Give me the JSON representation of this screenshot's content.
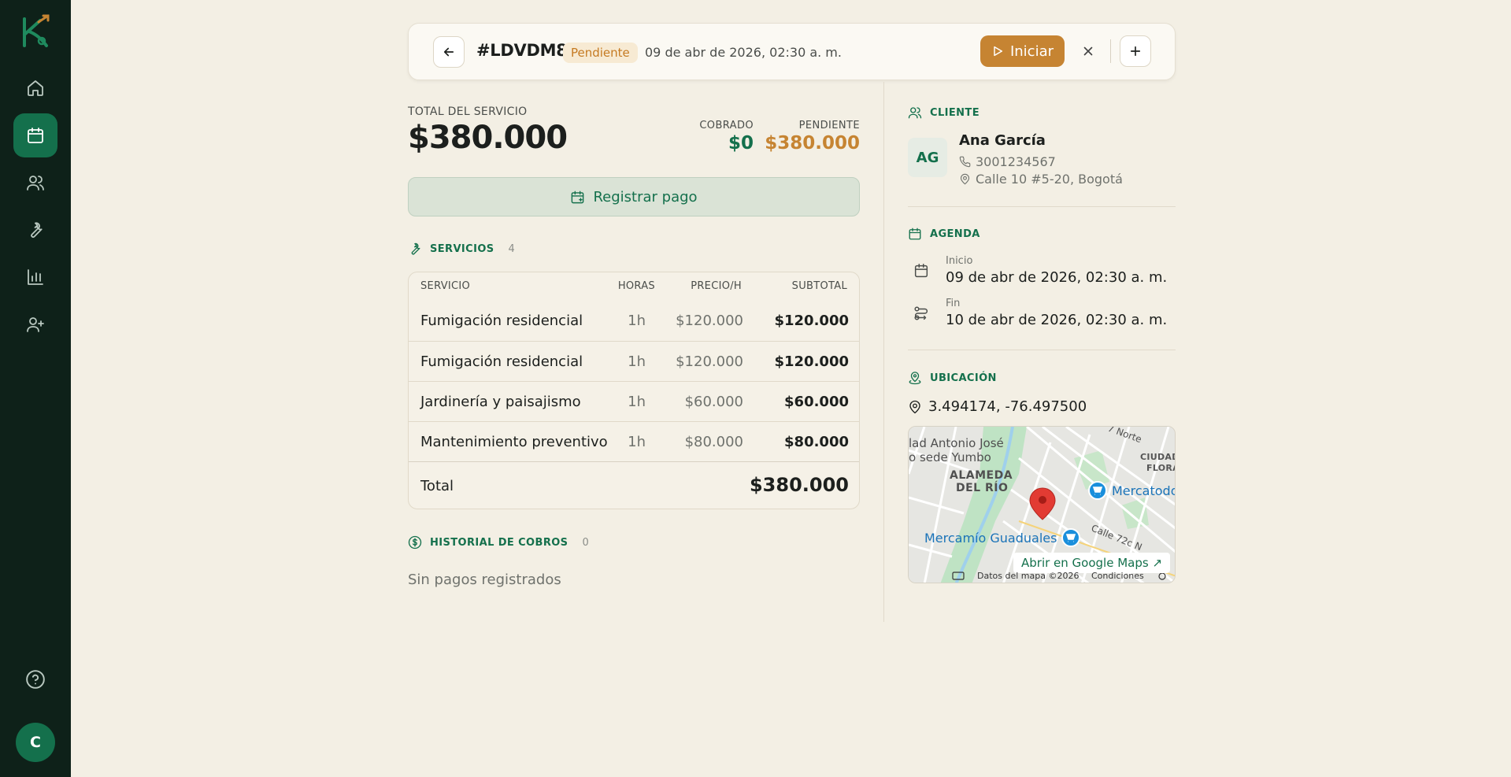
{
  "sidebar": {
    "user_initial": "C"
  },
  "header": {
    "order_id": "#LDVDM8",
    "status": "Pendiente",
    "date": "09 de abr de 2026, 02:30 a. m.",
    "start_label": "Iniciar"
  },
  "summary": {
    "total_label": "TOTAL DEL SERVICIO",
    "total_amount": "$380.000",
    "cobrado_label": "COBRADO",
    "cobrado_value": "$0",
    "pendiente_label": "PENDIENTE",
    "pendiente_value": "$380.000",
    "pay_button": "Registrar pago"
  },
  "services": {
    "title": "SERVICIOS",
    "count": "4",
    "headers": {
      "service": "SERVICIO",
      "hours": "HORAS",
      "price": "PRECIO/H",
      "subtotal": "SUBTOTAL"
    },
    "rows": [
      {
        "name": "Fumigación residencial",
        "hours": "1h",
        "price": "$120.000",
        "subtotal": "$120.000"
      },
      {
        "name": "Fumigación residencial",
        "hours": "1h",
        "price": "$120.000",
        "subtotal": "$120.000"
      },
      {
        "name": "Jardinería y paisajismo",
        "hours": "1h",
        "price": "$60.000",
        "subtotal": "$60.000"
      },
      {
        "name": "Mantenimiento preventivo",
        "hours": "1h",
        "price": "$80.000",
        "subtotal": "$80.000"
      }
    ],
    "total_label": "Total",
    "total_value": "$380.000"
  },
  "payments": {
    "title": "HISTORIAL DE COBROS",
    "count": "0",
    "empty": "Sin pagos registrados"
  },
  "client": {
    "title": "CLIENTE",
    "initials": "AG",
    "name": "Ana García",
    "phone": "3001234567",
    "address": "Calle 10 #5-20, Bogotá"
  },
  "agenda": {
    "title": "AGENDA",
    "start_label": "Inicio",
    "start_value": "09 de abr de 2026, 02:30 a. m.",
    "end_label": "Fin",
    "end_value": "10 de abr de 2026, 02:30 a. m."
  },
  "location": {
    "title": "UBICACIÓN",
    "coords": "3.494174, -76.497500",
    "map": {
      "label_1": "lad Antonio José",
      "label_2": "o sede Yumbo",
      "label_3": "ALAMEDA",
      "label_4": "DEL RÍO",
      "label_5": "Mercatodo",
      "label_6": "Mercamío Guaduales",
      "label_7": "CIUDADE",
      "label_8": "FLORAL",
      "label_9": "7 Norte",
      "label_10": "Calle 72c N",
      "open_link": "Abrir en Google Maps ↗",
      "data_label": "Datos del mapa ©2026",
      "terms_label": "Condiciones"
    }
  },
  "colors": {
    "sidebar_bg": "#0e2119",
    "accent_green": "#14704c",
    "accent_orange": "#c68432",
    "page_bg": "#f3efe4"
  }
}
